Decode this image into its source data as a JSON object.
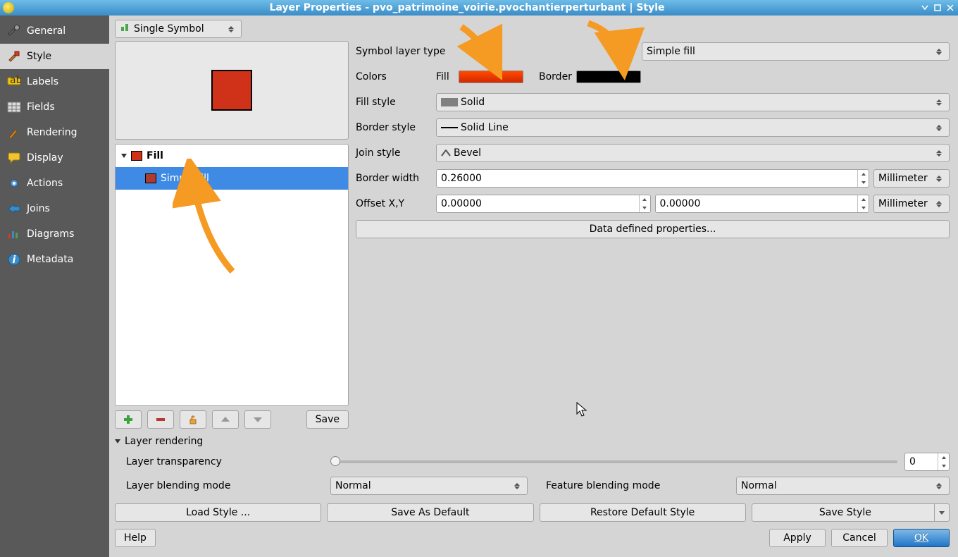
{
  "window": {
    "title": "Layer Properties - pvo_patrimoine_voirie.pvochantierperturbant | Style"
  },
  "sidebar": {
    "items": [
      {
        "label": "General"
      },
      {
        "label": "Style"
      },
      {
        "label": "Labels"
      },
      {
        "label": "Fields"
      },
      {
        "label": "Rendering"
      },
      {
        "label": "Display"
      },
      {
        "label": "Actions"
      },
      {
        "label": "Joins"
      },
      {
        "label": "Diagrams"
      },
      {
        "label": "Metadata"
      }
    ]
  },
  "symbolMode": "Single Symbol",
  "tree": {
    "fill_label": "Fill",
    "simplefill_label": "Simple fill"
  },
  "buttons": {
    "save": "Save",
    "data_defined": "Data defined properties...",
    "load_style": "Load Style ...",
    "save_default": "Save As Default",
    "restore_default": "Restore Default Style",
    "save_style": "Save Style",
    "help": "Help",
    "apply": "Apply",
    "cancel": "Cancel",
    "ok": "OK"
  },
  "form": {
    "symbol_layer_type_label": "Symbol layer type",
    "symbol_layer_type": "Simple fill",
    "colors_label": "Colors",
    "fill_label": "Fill",
    "border_label": "Border",
    "fill_style_label": "Fill style",
    "fill_style": "Solid",
    "border_style_label": "Border style",
    "border_style": "Solid Line",
    "join_style_label": "Join style",
    "join_style": "Bevel",
    "border_width_label": "Border width",
    "border_width": "0.26000",
    "border_width_unit": "Millimeter",
    "offset_label": "Offset X,Y",
    "offset_x": "0.00000",
    "offset_y": "0.00000",
    "offset_unit": "Millimeter"
  },
  "colors": {
    "fill": "#cf3219",
    "border": "#000000"
  },
  "render": {
    "section_label": "Layer rendering",
    "transparency_label": "Layer transparency",
    "transparency_value": "0",
    "lbm_label": "Layer blending mode",
    "lbm_value": "Normal",
    "fbm_label": "Feature blending mode",
    "fbm_value": "Normal"
  }
}
